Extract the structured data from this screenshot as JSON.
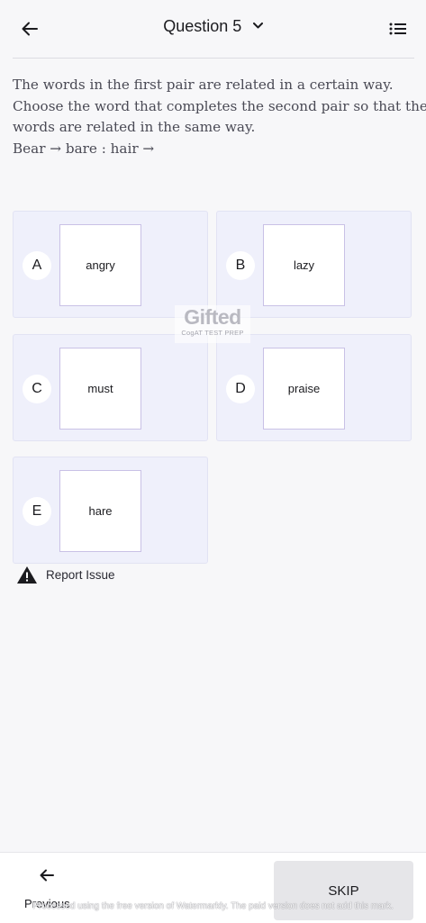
{
  "header": {
    "back_icon": "arrow-left-icon",
    "title": "Question 5",
    "dropdown_icon": "chevron-down-icon",
    "menu_icon": "list-icon"
  },
  "question": {
    "lines": [
      "The words in the first pair are related in a certain way.",
      "Choose the word that completes the second pair so that the",
      "words are related in the same way.",
      "Bear → bare : hair →"
    ]
  },
  "options": [
    {
      "letter": "A",
      "word": "angry"
    },
    {
      "letter": "B",
      "word": "lazy"
    },
    {
      "letter": "C",
      "word": "must"
    },
    {
      "letter": "D",
      "word": "praise"
    },
    {
      "letter": "E",
      "word": "hare"
    }
  ],
  "watermark_logo": {
    "brand": "Gifted",
    "tagline": "CogAT TEST PREP"
  },
  "report": {
    "icon": "warning-icon",
    "label": "Report Issue"
  },
  "footer": {
    "previous_icon": "arrow-left-icon",
    "previous_label": "Previous",
    "skip_label": "SKIP"
  },
  "overlay_text": "Processed using the free version of Watermarkly. The paid version does not add this mark.",
  "colors": {
    "option_bg": "#eff0fb",
    "card_border": "#c9c1e6",
    "skip_bg": "#e6e6e9",
    "page_bg": "#f7f7f9"
  }
}
